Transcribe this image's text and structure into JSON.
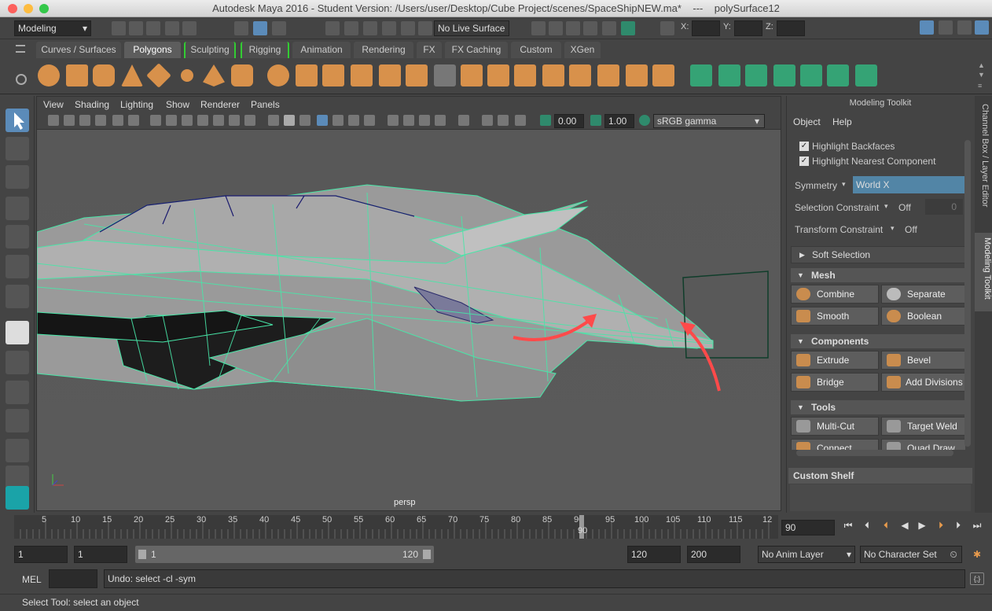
{
  "window": {
    "title": "Autodesk Maya 2016 - Student Version: /Users/user/Desktop/Cube Project/scenes/SpaceShipNEW.ma*    ---    polySurface12"
  },
  "status": {
    "menuset": "Modeling",
    "live_surface": "No Live Surface",
    "x_label": "X:",
    "y_label": "Y:",
    "z_label": "Z:"
  },
  "shelf": {
    "tabs": [
      "Curves / Surfaces",
      "Polygons",
      "Sculpting",
      "Rigging",
      "Animation",
      "Rendering",
      "FX",
      "FX Caching",
      "Custom",
      "XGen"
    ],
    "active_tab": "Polygons"
  },
  "viewport": {
    "menus": [
      "View",
      "Shading",
      "Lighting",
      "Show",
      "Renderer",
      "Panels"
    ],
    "exposure": "0.00",
    "gamma": "1.00",
    "color_space": "sRGB gamma",
    "camera_label": "persp",
    "accent": "#48e6a8"
  },
  "toolkit": {
    "title": "Modeling Toolkit",
    "menus": [
      "Object",
      "Help"
    ],
    "highlight_backfaces": "Highlight Backfaces",
    "highlight_nearest": "Highlight Nearest Component",
    "symmetry_label": "Symmetry",
    "symmetry_value": "World X",
    "selection_constraint_label": "Selection Constraint",
    "selection_constraint_value": "Off",
    "selection_constraint_num": "0",
    "transform_constraint_label": "Transform Constraint",
    "transform_constraint_value": "Off",
    "soft_selection": "Soft Selection",
    "mesh_section": "Mesh",
    "mesh_buttons": [
      "Combine",
      "Separate",
      "Smooth",
      "Boolean"
    ],
    "components_section": "Components",
    "component_buttons": [
      "Extrude",
      "Bevel",
      "Bridge",
      "Add Divisions"
    ],
    "tools_section": "Tools",
    "tool_buttons": [
      "Multi-Cut",
      "Target Weld",
      "Connect",
      "Quad Draw"
    ],
    "custom_shelf": "Custom Shelf"
  },
  "side_tabs": [
    "Channel Box / Layer Editor",
    "Modeling Toolkit"
  ],
  "timeline": {
    "ticks": [
      "5",
      "10",
      "15",
      "20",
      "25",
      "30",
      "35",
      "40",
      "45",
      "50",
      "55",
      "60",
      "65",
      "70",
      "75",
      "80",
      "85",
      "90",
      "95",
      "100",
      "105",
      "110",
      "115",
      "12"
    ],
    "current_frame": "90",
    "current_label": "90"
  },
  "range": {
    "start": "1",
    "anim_start": "1",
    "slider_start": "1",
    "slider_end": "120",
    "end": "120",
    "anim_end": "200",
    "anim_layer": "No Anim Layer",
    "character_set": "No Character Set"
  },
  "command": {
    "lang": "MEL",
    "result": "Undo: select -cl -sym"
  },
  "help": {
    "text": "Select Tool: select an object"
  },
  "colors": {
    "selection_wire": "#48e6a8",
    "arrow": "#ff4a4a",
    "orange_icon": "#d8914b"
  }
}
